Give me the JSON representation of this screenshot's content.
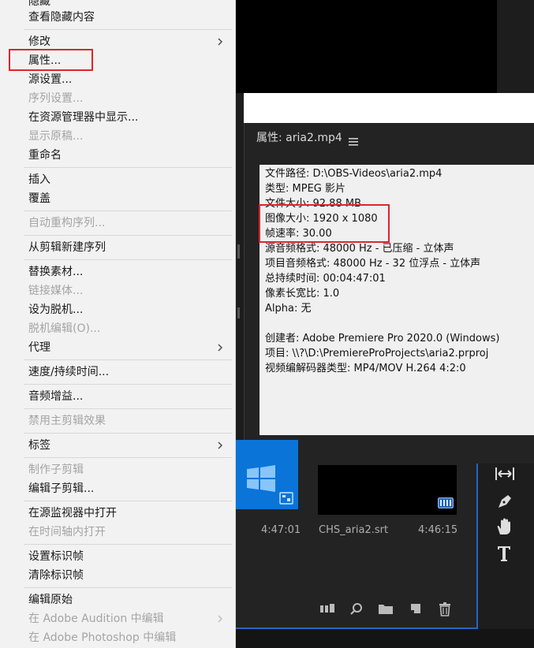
{
  "context_menu": {
    "items": [
      {
        "label": "隐藏",
        "disabled": false
      },
      {
        "label": "查看隐藏内容",
        "disabled": false
      },
      {
        "label": "修改",
        "disabled": false,
        "submenu": true
      },
      {
        "label": "属性...",
        "disabled": false,
        "highlighted": true
      },
      {
        "label": "源设置...",
        "disabled": false
      },
      {
        "label": "序列设置...",
        "disabled": true
      },
      {
        "label": "在资源管理器中显示...",
        "disabled": false
      },
      {
        "label": "显示原稿...",
        "disabled": true
      },
      {
        "label": "重命名",
        "disabled": false
      },
      {
        "label": "插入",
        "disabled": false
      },
      {
        "label": "覆盖",
        "disabled": false
      },
      {
        "label": "自动重构序列...",
        "disabled": true
      },
      {
        "label": "从剪辑新建序列",
        "disabled": false
      },
      {
        "label": "替换素材...",
        "disabled": false
      },
      {
        "label": "链接媒体...",
        "disabled": true
      },
      {
        "label": "设为脱机...",
        "disabled": false
      },
      {
        "label": "脱机编辑(O)...",
        "disabled": true
      },
      {
        "label": "代理",
        "disabled": false,
        "submenu": true
      },
      {
        "label": "速度/持续时间...",
        "disabled": false
      },
      {
        "label": "音频增益...",
        "disabled": false
      },
      {
        "label": "禁用主剪辑效果",
        "disabled": true
      },
      {
        "label": "标签",
        "disabled": false,
        "submenu": true
      },
      {
        "label": "制作子剪辑",
        "disabled": true
      },
      {
        "label": "编辑子剪辑...",
        "disabled": false
      },
      {
        "label": "在源监视器中打开",
        "disabled": false
      },
      {
        "label": "在时间轴内打开",
        "disabled": true
      },
      {
        "label": "设置标识帧",
        "disabled": false
      },
      {
        "label": "清除标识帧",
        "disabled": false
      },
      {
        "label": "编辑原始",
        "disabled": false
      },
      {
        "label": "在 Adobe Audition 中编辑",
        "disabled": true,
        "submenu": true
      },
      {
        "label": "在 Adobe Photoshop 中编辑",
        "disabled": true
      }
    ]
  },
  "properties_panel": {
    "title": "属性: aria2.mp4",
    "menu_icon": "hamburger-icon",
    "lines": [
      "文件路径: D:\\OBS-Videos\\aria2.mp4",
      "类型: MPEG 影片",
      "文件大小: 92.88 MB",
      "图像大小: 1920 x 1080",
      "帧速率: 30.00",
      "源音频格式: 48000 Hz - 已压缩 - 立体声",
      "项目音频格式: 48000 Hz - 32 位浮点 - 立体声",
      "总持续时间: 00:04:47:01",
      "像素长宽比: 1.0",
      "Alpha: 无",
      "",
      "创建者: Adobe Premiere Pro 2020.0 (Windows)",
      "项目: \\\\?\\D:\\PremiereProProjects\\aria2.prproj",
      "视频编解码器类型: MP4/MOV H.264 4:2:0"
    ]
  },
  "project_panel": {
    "clip1_duration": "4:47:01",
    "clip2_name": "CHS_aria2.srt",
    "clip2_duration": "4:46:15"
  },
  "colors": {
    "highlight_box": "#e0242b",
    "menu_bg": "#f2f2f2",
    "disabled_text": "#a4a4a4",
    "accent_blue": "#2a63c7"
  }
}
